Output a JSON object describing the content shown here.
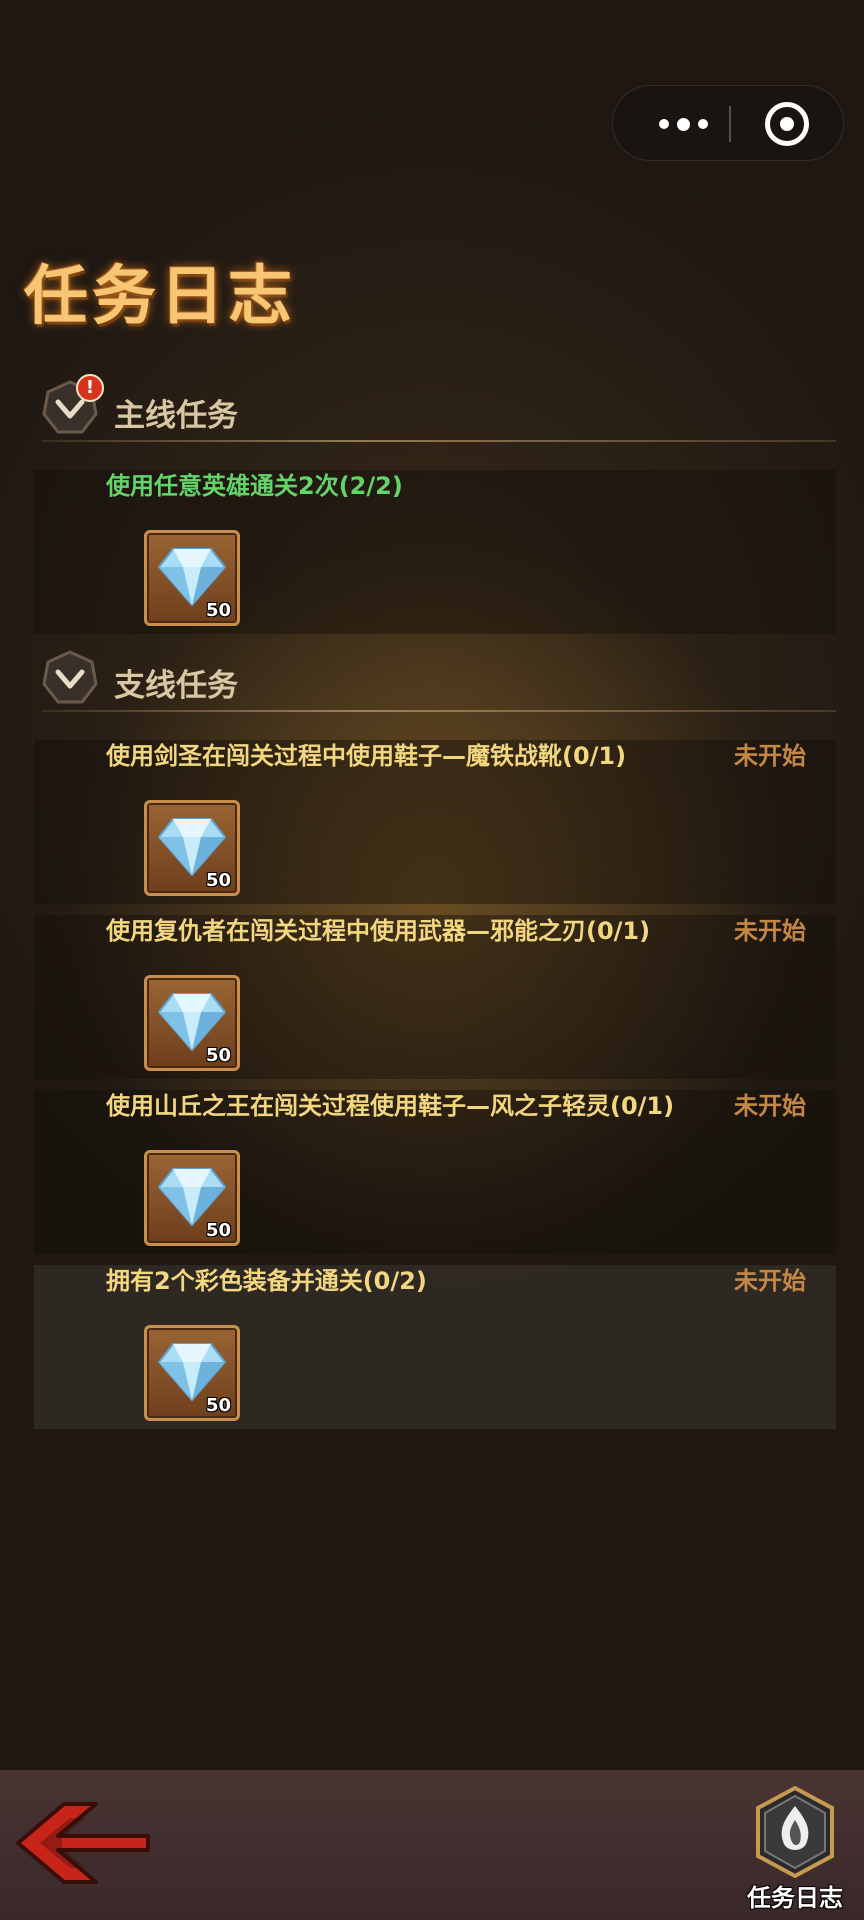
{
  "page_title": "任务日志",
  "main_section": {
    "label": "主线任务",
    "alert": "!"
  },
  "side_section": {
    "label": "支线任务"
  },
  "tasks": [
    {
      "text": "使用任意英雄通关2次(2/2)",
      "status": "",
      "reward_icon": "diamond-icon",
      "reward_qty": "50"
    },
    {
      "text": "使用剑圣在闯关过程中使用鞋子—魔铁战靴(0/1)",
      "status": "未开始",
      "reward_icon": "diamond-icon",
      "reward_qty": "50"
    },
    {
      "text": "使用复仇者在闯关过程中使用武器—邪能之刃(0/1)",
      "status": "未开始",
      "reward_icon": "diamond-icon",
      "reward_qty": "50"
    },
    {
      "text": "使用山丘之王在闯关过程使用鞋子—风之子轻灵(0/1)",
      "status": "未开始",
      "reward_icon": "diamond-icon",
      "reward_qty": "50"
    },
    {
      "text": "拥有2个彩色装备并通关(0/2)",
      "status": "未开始",
      "reward_icon": "diamond-icon",
      "reward_qty": "50"
    }
  ],
  "bottom_bar": {
    "journal_label": "任务日志"
  },
  "colors": {
    "completed_text": "#64d46a",
    "task_text": "#f2d680",
    "status_text": "#c58746",
    "title": "#f7c675"
  }
}
